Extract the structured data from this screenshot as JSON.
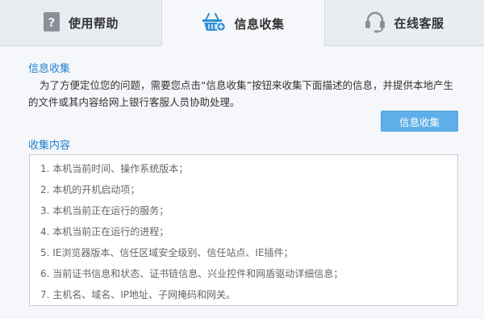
{
  "tabs": {
    "help": {
      "label": "使用帮助",
      "icon": "question-icon"
    },
    "collect": {
      "label": "信息收集",
      "icon": "basket-icon",
      "active": true
    },
    "service": {
      "label": "在线客服",
      "icon": "headset-icon"
    }
  },
  "info_section": {
    "title": "信息收集",
    "description": "为了方便定位您的问题，需要您点击“信息收集”按钮来收集下面描述的信息，并提供本地产生的文件或其内容给网上银行客服人员协助处理。",
    "button_label": "信息收集"
  },
  "content_section": {
    "title": "收集内容",
    "items": [
      "1. 本机当前时间、操作系统版本；",
      "2. 本机的开机启动项；",
      "3. 本机当前正在运行的服务；",
      "4. 本机当前正在运行的进程；",
      "5. IE浏览器版本、信任区域安全级别、信任站点、IE插件；",
      "6. 当前证书信息和状态、证书链信息、兴业控件和网盾驱动详细信息；",
      "7. 主机名、域名、IP地址、子网掩码和网关。"
    ]
  },
  "colors": {
    "accent": "#1e7fcf",
    "button": "#5fb0ea",
    "icon_blue": "#2e8fd8",
    "icon_gray": "#8a9098"
  }
}
